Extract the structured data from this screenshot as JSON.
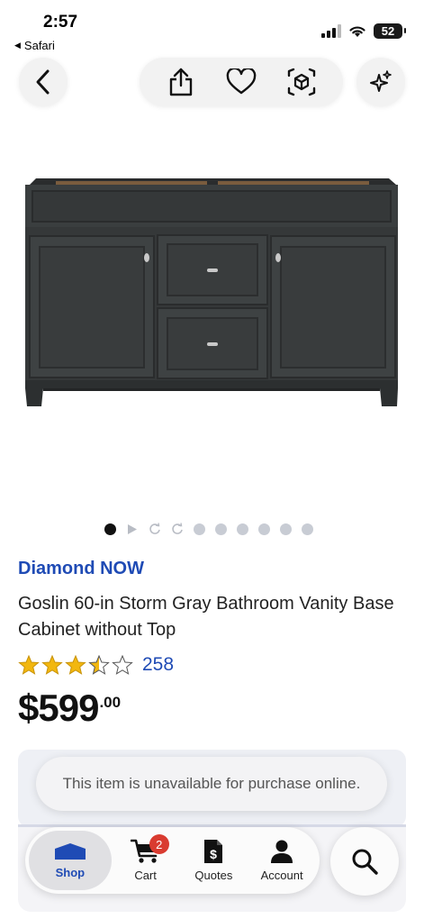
{
  "status_bar": {
    "time": "2:57",
    "back_app": "Safari",
    "battery": "52",
    "icons": [
      "signal-icon",
      "wifi-icon",
      "battery-icon"
    ]
  },
  "top_bar": {
    "back_icon": "chevron-left-icon",
    "actions": [
      "share-icon",
      "heart-icon",
      "ar-cube-icon",
      "sparkles-icon"
    ]
  },
  "product": {
    "image": "bathroom-vanity-cabinet-image",
    "carousel": {
      "total_indicators": 10,
      "active_index": 0,
      "indicator_types": [
        "image",
        "video",
        "360",
        "360",
        "image",
        "image",
        "image",
        "image",
        "image",
        "image"
      ]
    },
    "brand": "Diamond NOW",
    "title": "Goslin 60-in Storm Gray Bathroom Vanity Base Cabinet without Top",
    "rating": 3.5,
    "rating_max": 5,
    "review_count": "258",
    "price_main": "$599",
    "price_cents": ".00"
  },
  "notice": {
    "text": "This item is unavailable for purchase online."
  },
  "bottom_nav": {
    "items": [
      {
        "label": "Shop",
        "icon": "store-icon",
        "active": true
      },
      {
        "label": "Cart",
        "icon": "cart-icon",
        "badge": "2"
      },
      {
        "label": "Quotes",
        "icon": "quote-document-icon"
      },
      {
        "label": "Account",
        "icon": "person-icon"
      }
    ],
    "search_icon": "search-icon"
  },
  "colors": {
    "accent": "#1f4bb5",
    "badge": "#d93b30",
    "cabinet": "#3a3e3f"
  }
}
